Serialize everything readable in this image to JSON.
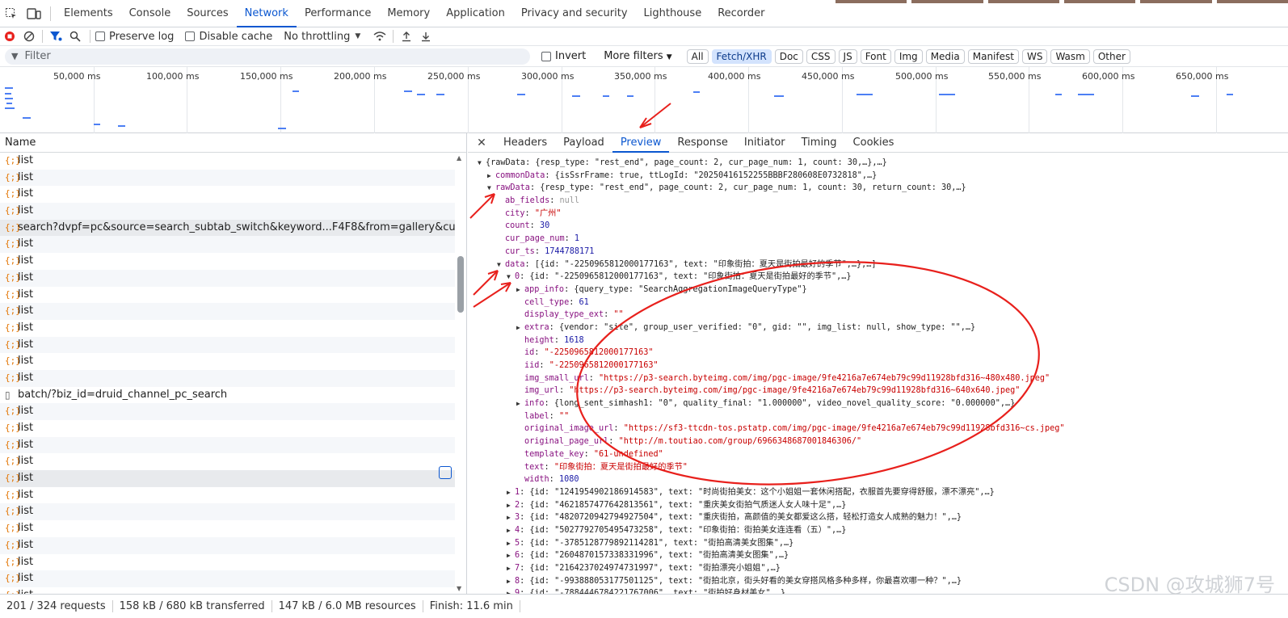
{
  "tabs": [
    "Elements",
    "Console",
    "Sources",
    "Network",
    "Performance",
    "Memory",
    "Application",
    "Privacy and security",
    "Lighthouse",
    "Recorder"
  ],
  "active_tab": "Network",
  "toolbar": {
    "preserve_log": "Preserve log",
    "disable_cache": "Disable cache",
    "throttling": "No throttling"
  },
  "filter": {
    "placeholder": "Filter",
    "invert": "Invert",
    "more_filters": "More filters",
    "types": [
      "All",
      "Fetch/XHR",
      "Doc",
      "CSS",
      "JS",
      "Font",
      "Img",
      "Media",
      "Manifest",
      "WS",
      "Wasm",
      "Other"
    ],
    "active_type": "Fetch/XHR"
  },
  "overview": {
    "ticks": [
      "50,000 ms",
      "100,000 ms",
      "150,000 ms",
      "200,000 ms",
      "250,000 ms",
      "300,000 ms",
      "350,000 ms",
      "400,000 ms",
      "450,000 ms",
      "500,000 ms",
      "550,000 ms",
      "600,000 ms",
      "650,000 ms"
    ]
  },
  "requests": {
    "column_name": "Name",
    "rows": [
      {
        "name": "list",
        "type": "xhr"
      },
      {
        "name": "list",
        "type": "xhr"
      },
      {
        "name": "list",
        "type": "xhr"
      },
      {
        "name": "list",
        "type": "xhr"
      },
      {
        "name": "search?dvpf=pc&source=search_subtab_switch&keyword...F4F8&from=gallery&cur_tab_title...",
        "type": "xhr"
      },
      {
        "name": "list",
        "type": "xhr"
      },
      {
        "name": "list",
        "type": "xhr"
      },
      {
        "name": "list",
        "type": "xhr"
      },
      {
        "name": "list",
        "type": "xhr"
      },
      {
        "name": "list",
        "type": "xhr"
      },
      {
        "name": "list",
        "type": "xhr"
      },
      {
        "name": "list",
        "type": "xhr"
      },
      {
        "name": "list",
        "type": "xhr"
      },
      {
        "name": "list",
        "type": "xhr"
      },
      {
        "name": "batch/?biz_id=druid_channel_pc_search",
        "type": "doc"
      },
      {
        "name": "list",
        "type": "xhr"
      },
      {
        "name": "list",
        "type": "xhr"
      },
      {
        "name": "list",
        "type": "xhr"
      },
      {
        "name": "list",
        "type": "xhr"
      },
      {
        "name": "list",
        "type": "xhr"
      },
      {
        "name": "list",
        "type": "xhr"
      },
      {
        "name": "list",
        "type": "xhr"
      },
      {
        "name": "list",
        "type": "xhr"
      },
      {
        "name": "list",
        "type": "xhr"
      },
      {
        "name": "list",
        "type": "xhr"
      },
      {
        "name": "list",
        "type": "xhr"
      },
      {
        "name": "list",
        "type": "xhr"
      }
    ]
  },
  "status": {
    "requests": "201 / 324 requests",
    "transferred": "158 kB / 680 kB transferred",
    "resources": "147 kB / 6.0 MB resources",
    "finish": "Finish: 11.6 min"
  },
  "detail_tabs": [
    "Headers",
    "Payload",
    "Preview",
    "Response",
    "Initiator",
    "Timing",
    "Cookies"
  ],
  "active_detail_tab": "Preview",
  "preview_lines": [
    {
      "indent": 0,
      "arrow": "down",
      "key": "",
      "text": "{rawData: {resp_type: \"rest_end\", page_count: 2, cur_page_num: 1, count: 30,…},…}",
      "kind": "plain"
    },
    {
      "indent": 1,
      "arrow": "right",
      "key": "commonData",
      "text": "{isSsrFrame: true, ttLogId: \"20250416152255BBBF280608E0732818\",…}",
      "kind": "plain"
    },
    {
      "indent": 1,
      "arrow": "down",
      "key": "rawData",
      "text": "{resp_type: \"rest_end\", page_count: 2, cur_page_num: 1, count: 30, return_count: 30,…}",
      "kind": "plain"
    },
    {
      "indent": 2,
      "arrow": "",
      "key": "ab_fields",
      "text": "null",
      "kind": "nul"
    },
    {
      "indent": 2,
      "arrow": "",
      "key": "city",
      "text": "\"广州\"",
      "kind": "str"
    },
    {
      "indent": 2,
      "arrow": "",
      "key": "count",
      "text": "30",
      "kind": "num"
    },
    {
      "indent": 2,
      "arrow": "",
      "key": "cur_page_num",
      "text": "1",
      "kind": "num"
    },
    {
      "indent": 2,
      "arrow": "",
      "key": "cur_ts",
      "text": "1744788171",
      "kind": "num"
    },
    {
      "indent": 2,
      "arrow": "down",
      "key": "data",
      "text": "[{id: \"-2250965812000177163\", text: \"印象街拍：夏天是街拍最好的季节\",…},…]",
      "kind": "plain"
    },
    {
      "indent": 3,
      "arrow": "down",
      "key": "0",
      "text": "{id: \"-2250965812000177163\", text: \"印象街拍：夏天是街拍最好的季节\",…}",
      "kind": "plain"
    },
    {
      "indent": 4,
      "arrow": "right",
      "key": "app_info",
      "text": "{query_type: \"SearchAggregationImageQueryType\"}",
      "kind": "plain"
    },
    {
      "indent": 4,
      "arrow": "",
      "key": "cell_type",
      "text": "61",
      "kind": "num"
    },
    {
      "indent": 4,
      "arrow": "",
      "key": "display_type_ext",
      "text": "\"\"",
      "kind": "str"
    },
    {
      "indent": 4,
      "arrow": "right",
      "key": "extra",
      "text": "{vendor: \"site\", group_user_verified: \"0\", gid: \"\", img_list: null, show_type: \"\",…}",
      "kind": "plain"
    },
    {
      "indent": 4,
      "arrow": "",
      "key": "height",
      "text": "1618",
      "kind": "num"
    },
    {
      "indent": 4,
      "arrow": "",
      "key": "id",
      "text": "\"-2250965812000177163\"",
      "kind": "str"
    },
    {
      "indent": 4,
      "arrow": "",
      "key": "iid",
      "text": "\"-2250965812000177163\"",
      "kind": "str"
    },
    {
      "indent": 4,
      "arrow": "",
      "key": "img_small_url",
      "text": "\"https://p3-search.byteimg.com/img/pgc-image/9fe4216a7e674eb79c99d11928bfd316~480x480.jpeg\"",
      "kind": "str"
    },
    {
      "indent": 4,
      "arrow": "",
      "key": "img_url",
      "text": "\"https://p3-search.byteimg.com/img/pgc-image/9fe4216a7e674eb79c99d11928bfd316~640x640.jpeg\"",
      "kind": "str"
    },
    {
      "indent": 4,
      "arrow": "right",
      "key": "info",
      "text": "{long_sent_simhash1: \"0\", quality_final: \"1.000000\", video_novel_quality_score: \"0.000000\",…}",
      "kind": "plain"
    },
    {
      "indent": 4,
      "arrow": "",
      "key": "label",
      "text": "\"\"",
      "kind": "str"
    },
    {
      "indent": 4,
      "arrow": "",
      "key": "original_image_url",
      "text": "\"https://sf3-ttcdn-tos.pstatp.com/img/pgc-image/9fe4216a7e674eb79c99d11928bfd316~cs.jpeg\"",
      "kind": "str"
    },
    {
      "indent": 4,
      "arrow": "",
      "key": "original_page_url",
      "text": "\"http://m.toutiao.com/group/6966348687001846306/\"",
      "kind": "str"
    },
    {
      "indent": 4,
      "arrow": "",
      "key": "template_key",
      "text": "\"61-undefined\"",
      "kind": "str"
    },
    {
      "indent": 4,
      "arrow": "",
      "key": "text",
      "text": "\"印象街拍：夏天是街拍最好的季节\"",
      "kind": "str"
    },
    {
      "indent": 4,
      "arrow": "",
      "key": "width",
      "text": "1080",
      "kind": "num"
    },
    {
      "indent": 3,
      "arrow": "right",
      "key": "1",
      "text": "{id: \"1241954902186914583\", text: \"时尚街拍美女：这个小姐姐一套休闲搭配，衣服首先要穿得舒服，漂不漂亮\",…}",
      "kind": "plain"
    },
    {
      "indent": 3,
      "arrow": "right",
      "key": "2",
      "text": "{id: \"4621857477642813561\", text: \"重庆美女街拍气质迷人女人味十足\",…}",
      "kind": "plain"
    },
    {
      "indent": 3,
      "arrow": "right",
      "key": "3",
      "text": "{id: \"4820720942794927504\", text: \"重庆街拍，高颜值的美女都爱这么搭，轻松打造女人成熟的魅力！\",…}",
      "kind": "plain"
    },
    {
      "indent": 3,
      "arrow": "right",
      "key": "4",
      "text": "{id: \"5027792705495473258\", text: \"印象街拍：街拍美女连连看（五）\",…}",
      "kind": "plain"
    },
    {
      "indent": 3,
      "arrow": "right",
      "key": "5",
      "text": "{id: \"-3785128779892114281\", text: \"街拍高清美女图集\",…}",
      "kind": "plain"
    },
    {
      "indent": 3,
      "arrow": "right",
      "key": "6",
      "text": "{id: \"2604870157338331996\", text: \"街拍高清美女图集\",…}",
      "kind": "plain"
    },
    {
      "indent": 3,
      "arrow": "right",
      "key": "7",
      "text": "{id: \"2164237024974731997\", text: \"街拍漂亮小姐姐\",…}",
      "kind": "plain"
    },
    {
      "indent": 3,
      "arrow": "right",
      "key": "8",
      "text": "{id: \"-993888053177501125\", text: \"街拍北京，街头好看的美女穿搭风格多种多样，你最喜欢哪一种？\",…}",
      "kind": "plain"
    },
    {
      "indent": 3,
      "arrow": "right",
      "key": "9",
      "text": "{id: \"-7884446784221767006\", text: \"街拍好身材美女\",…}",
      "kind": "plain"
    }
  ],
  "watermark": "CSDN @攻城狮7号",
  "colors": {
    "accent": "#0b57d0",
    "annotation": "#e8201c",
    "xhr_icon": "#e37400"
  }
}
